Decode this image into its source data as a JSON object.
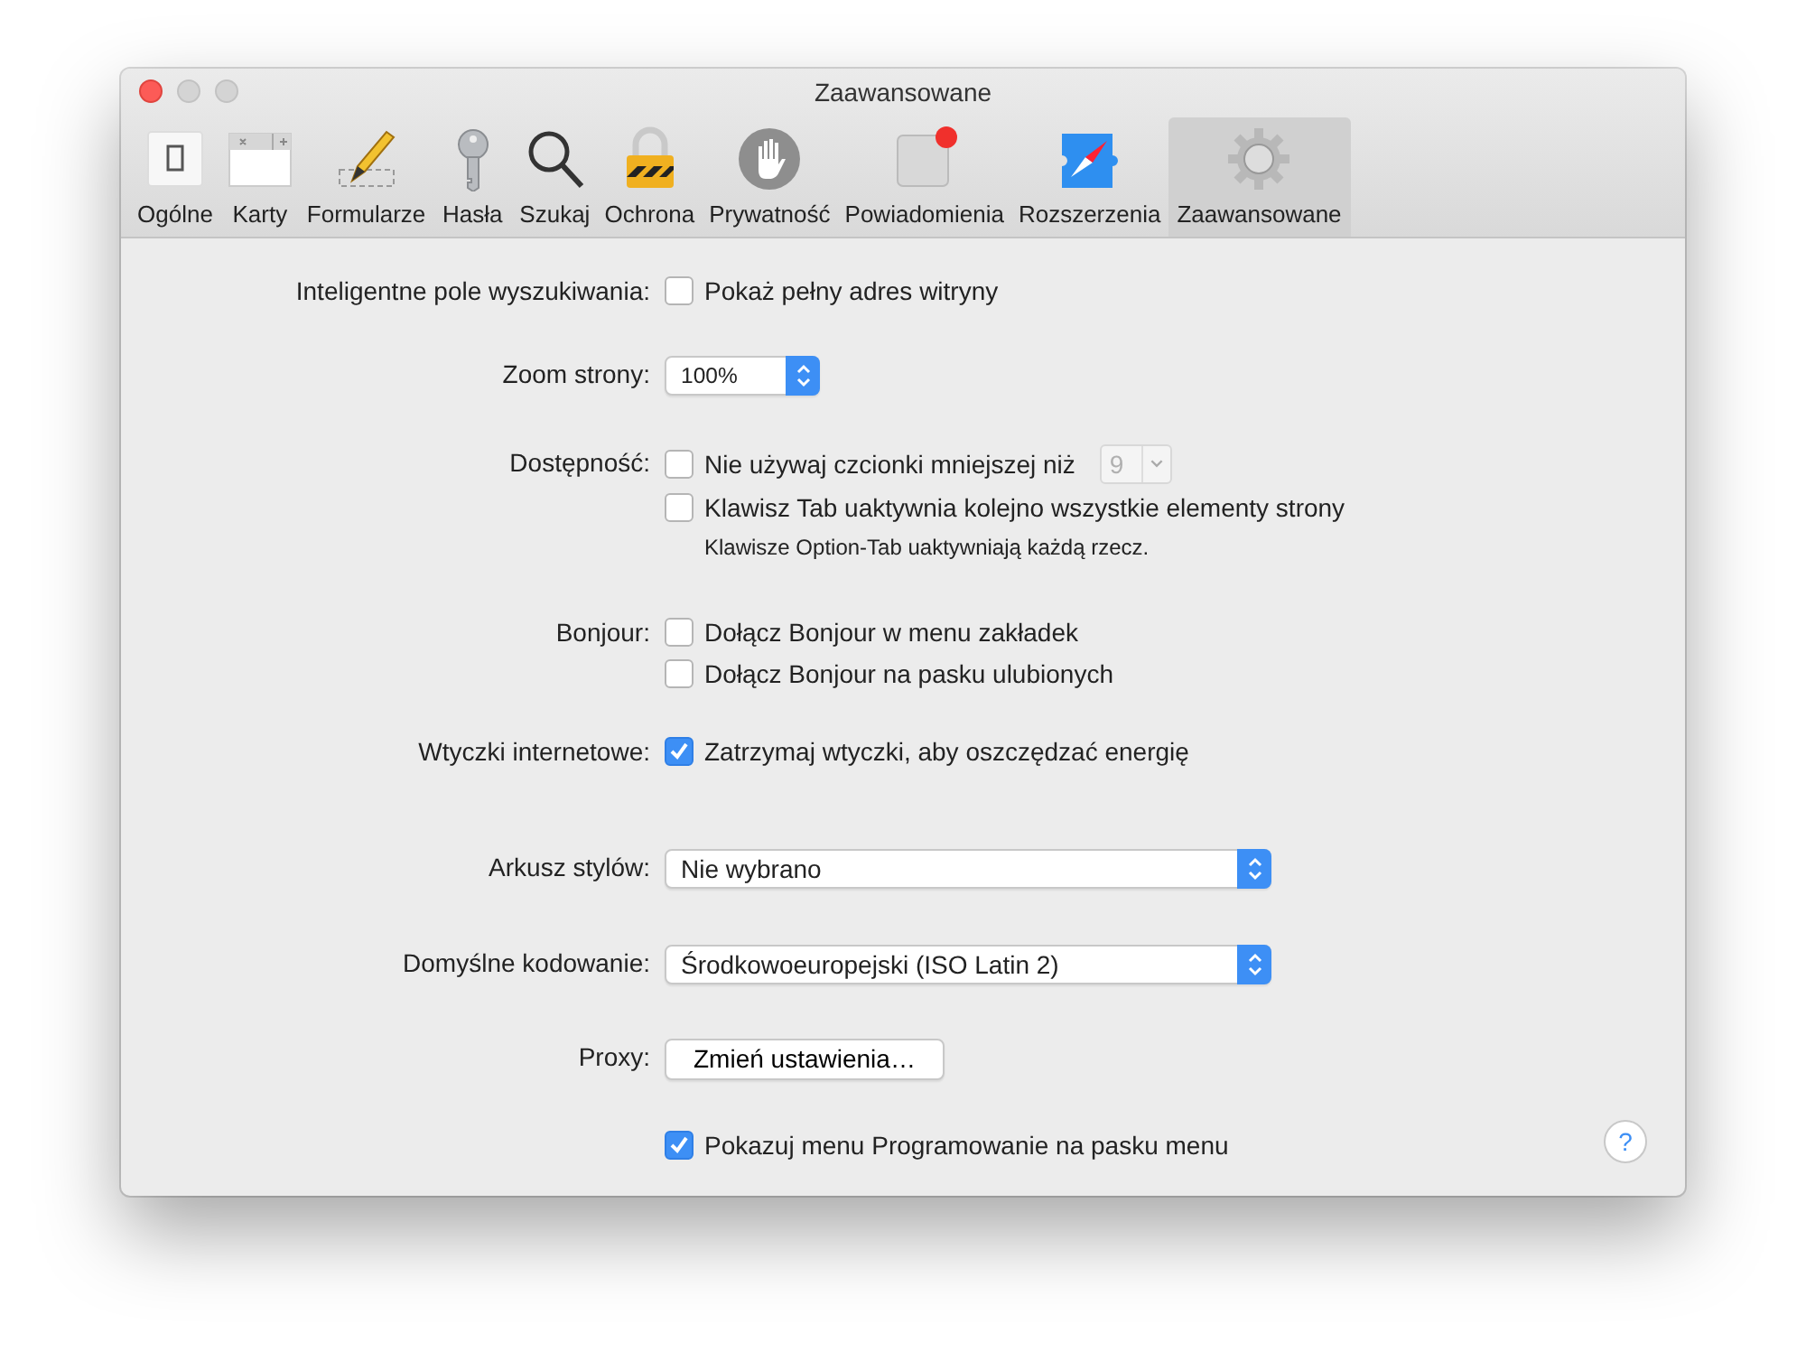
{
  "window": {
    "title": "Zaawansowane"
  },
  "tabs": [
    {
      "label": "Ogólne",
      "selected": false
    },
    {
      "label": "Karty",
      "selected": false
    },
    {
      "label": "Formularze",
      "selected": false
    },
    {
      "label": "Hasła",
      "selected": false
    },
    {
      "label": "Szukaj",
      "selected": false
    },
    {
      "label": "Ochrona",
      "selected": false
    },
    {
      "label": "Prywatność",
      "selected": false
    },
    {
      "label": "Powiadomienia",
      "selected": false
    },
    {
      "label": "Rozszerzenia",
      "selected": false
    },
    {
      "label": "Zaawansowane",
      "selected": true
    }
  ],
  "settings": [
    {
      "label": "Inteligentne pole wyszukiwania:",
      "items": [
        {
          "kind": "checkbox",
          "label": "Pokaż pełny adres witryny",
          "checked": false
        }
      ]
    },
    {
      "label": "Zoom strony:",
      "items": [
        {
          "kind": "popup",
          "value": "100%",
          "wide": false
        }
      ]
    },
    {
      "label": "Dostępność:",
      "items": [
        {
          "kind": "checkbox",
          "label": "Nie używaj czcionki mniejszej niż",
          "checked": false,
          "font_size": {
            "value": "9",
            "disabled": true
          }
        },
        {
          "kind": "checkbox",
          "label": "Klawisz Tab uaktywnia kolejno wszystkie elementy strony",
          "checked": false
        },
        {
          "kind": "note",
          "label": "Klawisze Option-Tab uaktywniają każdą rzecz."
        }
      ]
    },
    {
      "label": "Bonjour:",
      "items": [
        {
          "kind": "checkbox",
          "label": "Dołącz Bonjour w menu zakładek",
          "checked": false
        },
        {
          "kind": "checkbox",
          "label": "Dołącz Bonjour na pasku ulubionych",
          "checked": false
        }
      ]
    },
    {
      "label": "Wtyczki internetowe:",
      "items": [
        {
          "kind": "checkbox",
          "label": "Zatrzymaj wtyczki, aby oszczędzać energię",
          "checked": true
        }
      ]
    },
    {
      "label": "Arkusz stylów:",
      "items": [
        {
          "kind": "popup",
          "value": "Nie wybrano",
          "wide": true
        }
      ]
    },
    {
      "label": "Domyślne kodowanie:",
      "items": [
        {
          "kind": "popup",
          "value": "Środkowoeuropejski (ISO Latin 2)",
          "wide": true
        }
      ]
    },
    {
      "label": "Proxy:",
      "items": [
        {
          "kind": "button",
          "label": "Zmień ustawienia…"
        }
      ]
    },
    {
      "items": [
        {
          "kind": "checkbox",
          "label": "Pokazuj menu Programowanie na pasku menu",
          "checked": true
        }
      ]
    }
  ],
  "help_button": {
    "label": "?"
  }
}
